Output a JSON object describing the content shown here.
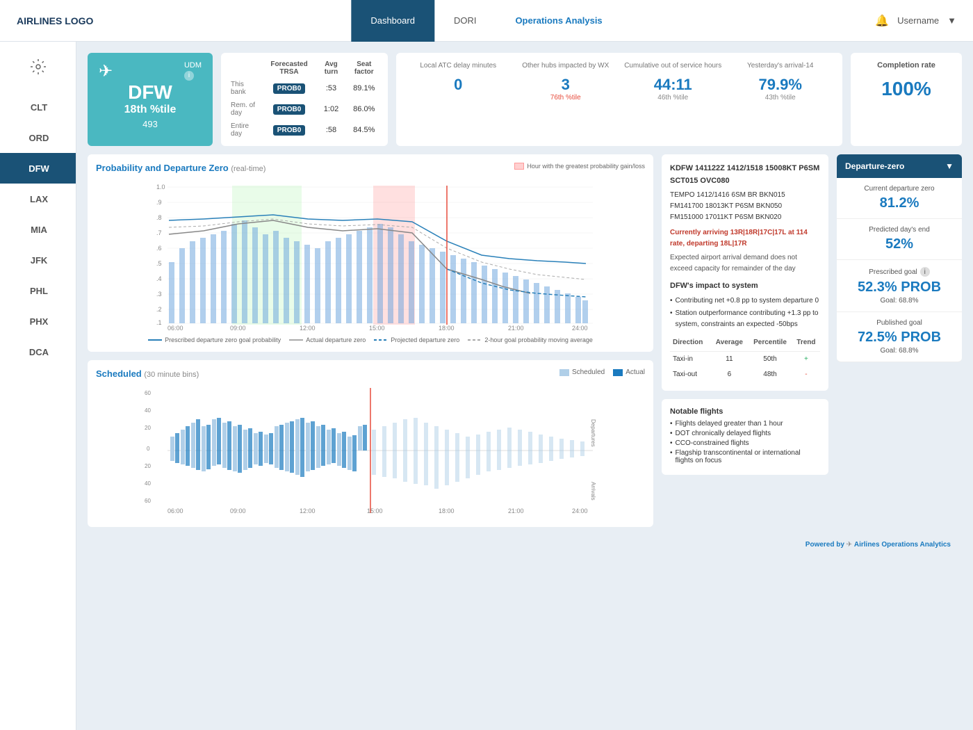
{
  "nav": {
    "logo": "AIRLINES LOGO",
    "links": [
      {
        "label": "Dashboard",
        "active": true
      },
      {
        "label": "DORI",
        "active": false
      },
      {
        "label": "Operations Analysis",
        "active": false,
        "highlight": true
      }
    ],
    "username": "Username",
    "bell_icon": "🔔"
  },
  "sidebar": {
    "settings_icon": "⚙",
    "items": [
      {
        "label": "CLT",
        "active": false
      },
      {
        "label": "ORD",
        "active": false
      },
      {
        "label": "DFW",
        "active": true
      },
      {
        "label": "LAX",
        "active": false
      },
      {
        "label": "MIA",
        "active": false
      },
      {
        "label": "JFK",
        "active": false
      },
      {
        "label": "PHL",
        "active": false
      },
      {
        "label": "PHX",
        "active": false
      },
      {
        "label": "DCA",
        "active": false
      }
    ]
  },
  "udm_card": {
    "airport": "DFW",
    "udm_label": "UDM",
    "percentile": "18th %tile",
    "number": "493",
    "info": "i"
  },
  "trsa_table": {
    "col_forecasted": "Forecasted TRSA",
    "col_avg_turn": "Avg turn",
    "col_seat_factor": "Seat factor",
    "rows": [
      {
        "bank": "This bank",
        "forecasted": "PROB0",
        "avg_turn": ":53",
        "seat_factor": "89.1%"
      },
      {
        "bank": "Rem. of day",
        "forecasted": "PROB0",
        "avg_turn": "1:02",
        "seat_factor": "86.0%"
      },
      {
        "bank": "Entire day",
        "forecasted": "PROB0",
        "avg_turn": ":58",
        "seat_factor": "84.5%"
      }
    ]
  },
  "atc_stats": {
    "cols": [
      {
        "label": "Local ATC delay minutes",
        "value": "0"
      },
      {
        "label": "Other hubs impacted by WX",
        "value": "3",
        "percentile": "76th %tile"
      },
      {
        "label": "Cumulative out of service hours",
        "value": "44:11",
        "percentile": "46th %tile"
      },
      {
        "label": "Yesterday's arrival-14",
        "value": "79.9%",
        "percentile": "43th %tile"
      }
    ]
  },
  "completion_card": {
    "label": "Completion rate",
    "value": "100%"
  },
  "probability_chart": {
    "title": "Probability and Departure Zero",
    "subtitle": "(real-time)",
    "legend": [
      {
        "label": "Prescribed departure zero goal probability",
        "type": "solid-blue"
      },
      {
        "label": "Actual departure zero",
        "type": "solid-gray"
      },
      {
        "label": "Projected departure zero",
        "type": "dashed-blue"
      },
      {
        "label": "2-hour goal probability moving average",
        "type": "dashed-gray"
      }
    ],
    "greatest_label": "Hour with the greatest probability gain/loss",
    "x_labels": [
      "06:00",
      "09:00",
      "12:00",
      "15:00",
      "18:00",
      "21:00",
      "24:00"
    ],
    "y_labels": [
      "1.0",
      ".9",
      ".8",
      ".7",
      ".6",
      ".5",
      ".4",
      ".3",
      ".2",
      ".1"
    ]
  },
  "scheduled_chart": {
    "title": "Scheduled",
    "subtitle": "(30 minute bins)",
    "legend_scheduled": "Scheduled",
    "legend_actual": "Actual",
    "x_labels": [
      "06:00",
      "09:00",
      "12:00",
      "15:00",
      "18:00",
      "21:00",
      "24:00"
    ],
    "y_labels_departures": [
      "60",
      "40",
      "20",
      "0"
    ],
    "y_labels_arrivals": [
      "20",
      "40",
      "60"
    ],
    "axis_departures": "Departures",
    "axis_arrivals": "Arrivals"
  },
  "weather": {
    "metar": "KDFW 141122Z 1412/1518 15008KT P6SM SCT015 OVC080",
    "tempo1": "TEMPO 1412/1416 6SM BR BKN015",
    "tempo2": "FM141700 18013KT P6SM BKN050",
    "tempo3": "FM151000 17011KT P6SM BKN020",
    "arriving_info": "Currently arriving 13R|18R|17C|17L at 114 rate, departing 18L|17R",
    "demand_note": "Expected airport arrival demand does not exceed capacity for remainder of the day",
    "impact_title": "DFW's impact to system",
    "bullets": [
      "Contributing net +0.8 pp to system departure 0",
      "Station outperformance contributing +1.3 pp to system, constraints an expected -50bps"
    ],
    "taxi_table": {
      "headers": [
        "Direction",
        "Average",
        "Percentile",
        "Trend"
      ],
      "rows": [
        {
          "direction": "Taxi-in",
          "average": "11",
          "percentile": "50th",
          "trend": "+"
        },
        {
          "direction": "Taxi-out",
          "average": "6",
          "percentile": "48th",
          "trend": "-"
        }
      ]
    }
  },
  "notable_flights": {
    "title": "Notable flights",
    "items": [
      "Flights delayed greater than 1 hour",
      "DOT chronically delayed flights",
      "CCO-constrained flights",
      "Flagship transcontinental or international flights on focus"
    ]
  },
  "departure_zero": {
    "header": "Departure-zero",
    "dropdown_icon": "▼",
    "sections": [
      {
        "label": "Current departure zero",
        "value": "81.2%",
        "sub": ""
      },
      {
        "label": "Predicted day's end",
        "value": "52%",
        "sub": ""
      },
      {
        "label": "Prescribed goal",
        "value": "52.3% PROB",
        "goal": "Goal: 68.8%",
        "has_info": true
      },
      {
        "label": "Published goal",
        "value": "72.5% PROB",
        "goal": "Goal: 68.8%"
      }
    ]
  },
  "footer": {
    "powered_by": "Powered by",
    "brand": "Airlines Operations Analytics"
  }
}
